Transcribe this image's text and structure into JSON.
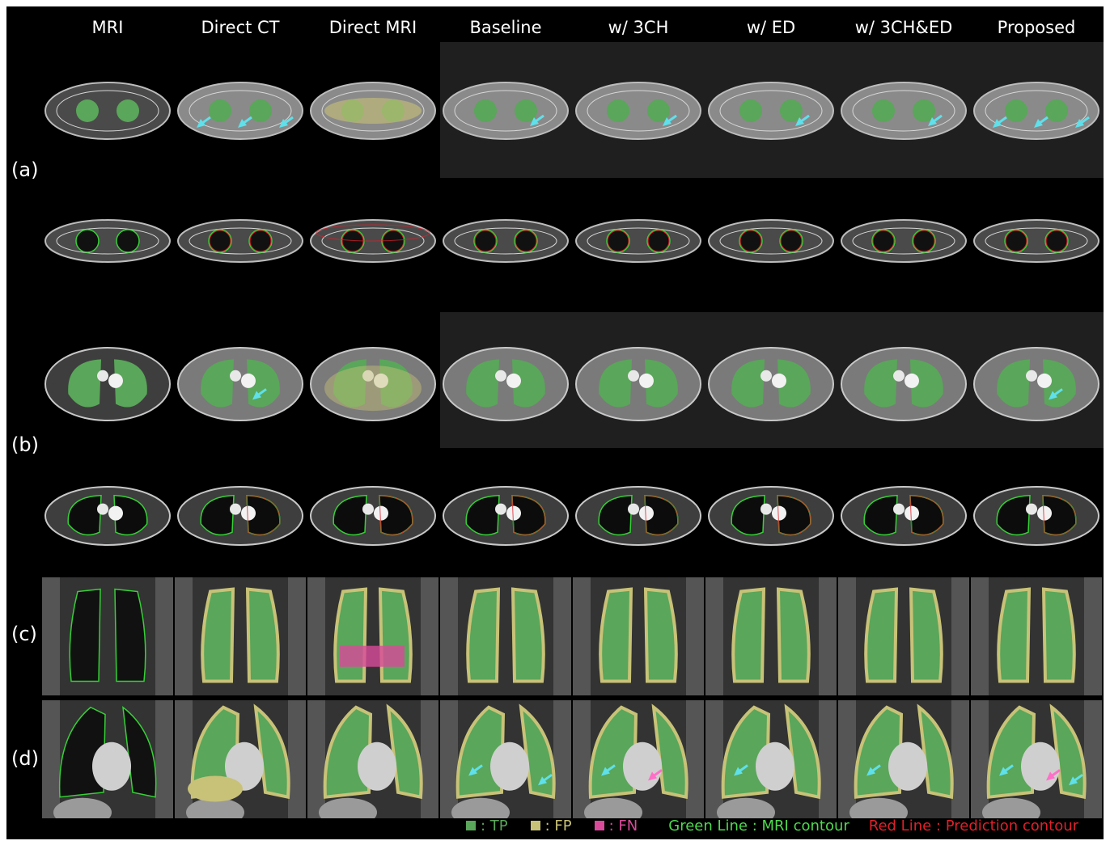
{
  "columns": [
    "MRI",
    "Direct CT",
    "Direct MRI",
    "Baseline",
    "w/ 3CH",
    "w/ ED",
    "w/ 3CH&ED",
    "Proposed"
  ],
  "row_labels": [
    "(a)",
    "(b)",
    "(c)",
    "(d)"
  ],
  "legend": {
    "tp_label": ": TP",
    "fp_label": ": FP",
    "fn_label": ": FN",
    "green_line_label": "Green Line : MRI contour",
    "red_line_label": "Red Line : Prediction contour"
  },
  "colors": {
    "tp": "#5aa65a",
    "fp": "#c8c278",
    "fn": "#d94a9a",
    "green_line": "#36d136",
    "red_line": "#e0202a",
    "arrow_cyan": "#5fe0ea",
    "arrow_pink": "#ff6fc8"
  }
}
